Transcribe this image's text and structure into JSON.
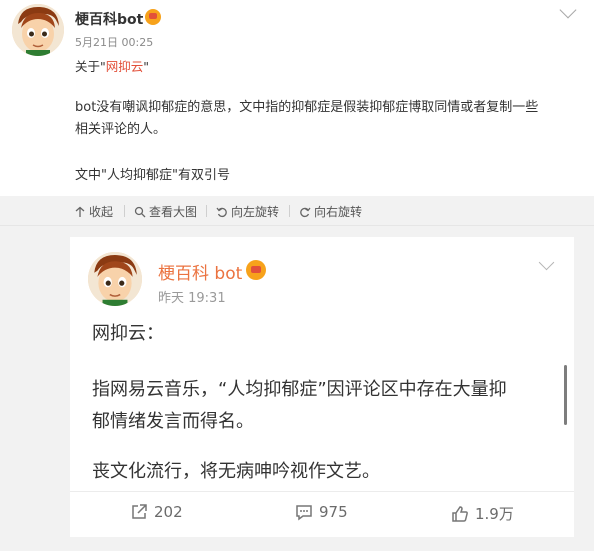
{
  "post": {
    "author": "梗百科bot",
    "timestamp": "5月21日 00:25",
    "about_prefix": "关于\"",
    "about_link": "网抑云",
    "about_suffix": "\"",
    "body_line1": "bot没有嘲讽抑郁症的意思，文中指的抑郁症是假装抑郁症博取同情或者复制一些",
    "body_line2": "相关评论的人。",
    "note": "文中\"人均抑郁症\"有双引号"
  },
  "actions": {
    "collapse": "收起",
    "view_large": "查看大图",
    "rotate_left": "向左旋转",
    "rotate_right": "向右旋转"
  },
  "card": {
    "author": "梗百科 bot",
    "timestamp": "昨天 19:31",
    "title": "网抑云：",
    "paragraph1_line1": "指网易云音乐，“人均抑郁症”因评论区中存在大量抑",
    "paragraph1_line2": "郁情绪发言而得名。",
    "paragraph2": "丧文化流行，将无病呻吟视作文艺。",
    "shares": "202",
    "comments": "975",
    "likes": "1.9万"
  },
  "colors": {
    "link": "#e2503a",
    "card_author": "#eb7340",
    "backdrop": "#f2f2f2"
  },
  "icons": [
    "vip-badge-icon",
    "chevron-down-icon",
    "collapse-icon",
    "zoom-icon",
    "rotate-left-icon",
    "rotate-right-icon",
    "share-icon",
    "comment-icon",
    "like-icon"
  ]
}
